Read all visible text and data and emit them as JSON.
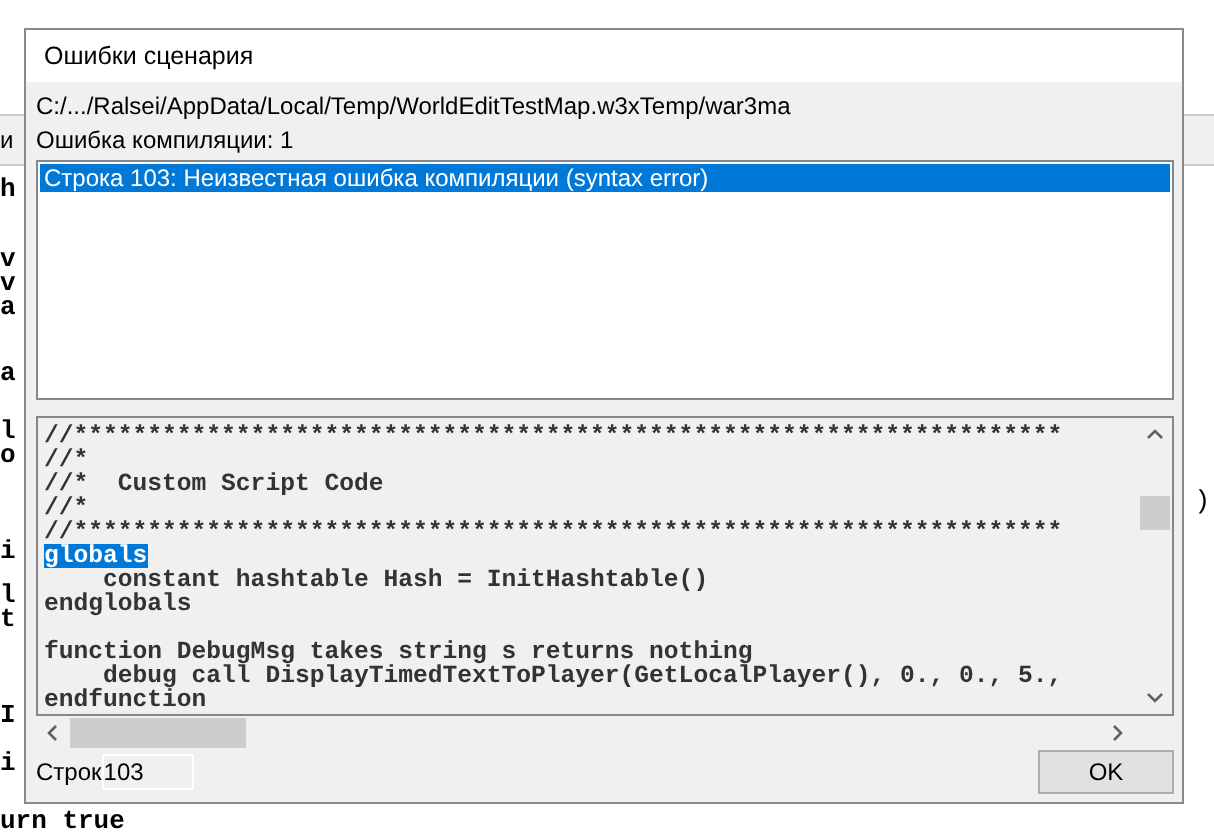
{
  "editor": {
    "toolbar_label": "и",
    "fragment_groups": [
      [
        "h"
      ],
      [
        "v",
        "v",
        "a"
      ],
      [
        "a"
      ],
      [
        "l",
        "o"
      ],
      [
        "i"
      ],
      [
        "l",
        "t"
      ],
      [
        "I"
      ],
      [
        "i"
      ],
      [
        "urn true"
      ]
    ],
    "right_fragment": ")"
  },
  "dialog": {
    "title": "Ошибки сценария",
    "path": "C:/.../Ralsei/AppData/Local/Temp/WorldEditTestMap.w3xTemp/war3ma",
    "error_count": "Ошибка компиляции: 1",
    "errors": [
      {
        "text": "Строка 103: Неизвестная ошибка компиляции (syntax error)",
        "selected": true
      }
    ],
    "code_blocks": [
      [
        {
          "text": "//*******************************************************************",
          "selected": false
        },
        {
          "text": "//*",
          "selected": false
        },
        {
          "text": "//*  Custom Script Code",
          "selected": false
        },
        {
          "text": "//*",
          "selected": false
        },
        {
          "text": "//*******************************************************************",
          "selected": false
        },
        {
          "text": "globals",
          "selected": true
        },
        {
          "text": "    constant hashtable Hash = InitHashtable()",
          "selected": false
        },
        {
          "text": "endglobals",
          "selected": false
        }
      ],
      [
        {
          "text": "function DebugMsg takes string s returns nothing",
          "selected": false
        },
        {
          "text": "    debug call DisplayTimedTextToPlayer(GetLocalPlayer(), 0., 0., 5.,",
          "selected": false
        },
        {
          "text": "endfunction",
          "selected": false
        }
      ]
    ],
    "line_label": "Строк",
    "line_value": "103",
    "ok_button": "OK"
  }
}
